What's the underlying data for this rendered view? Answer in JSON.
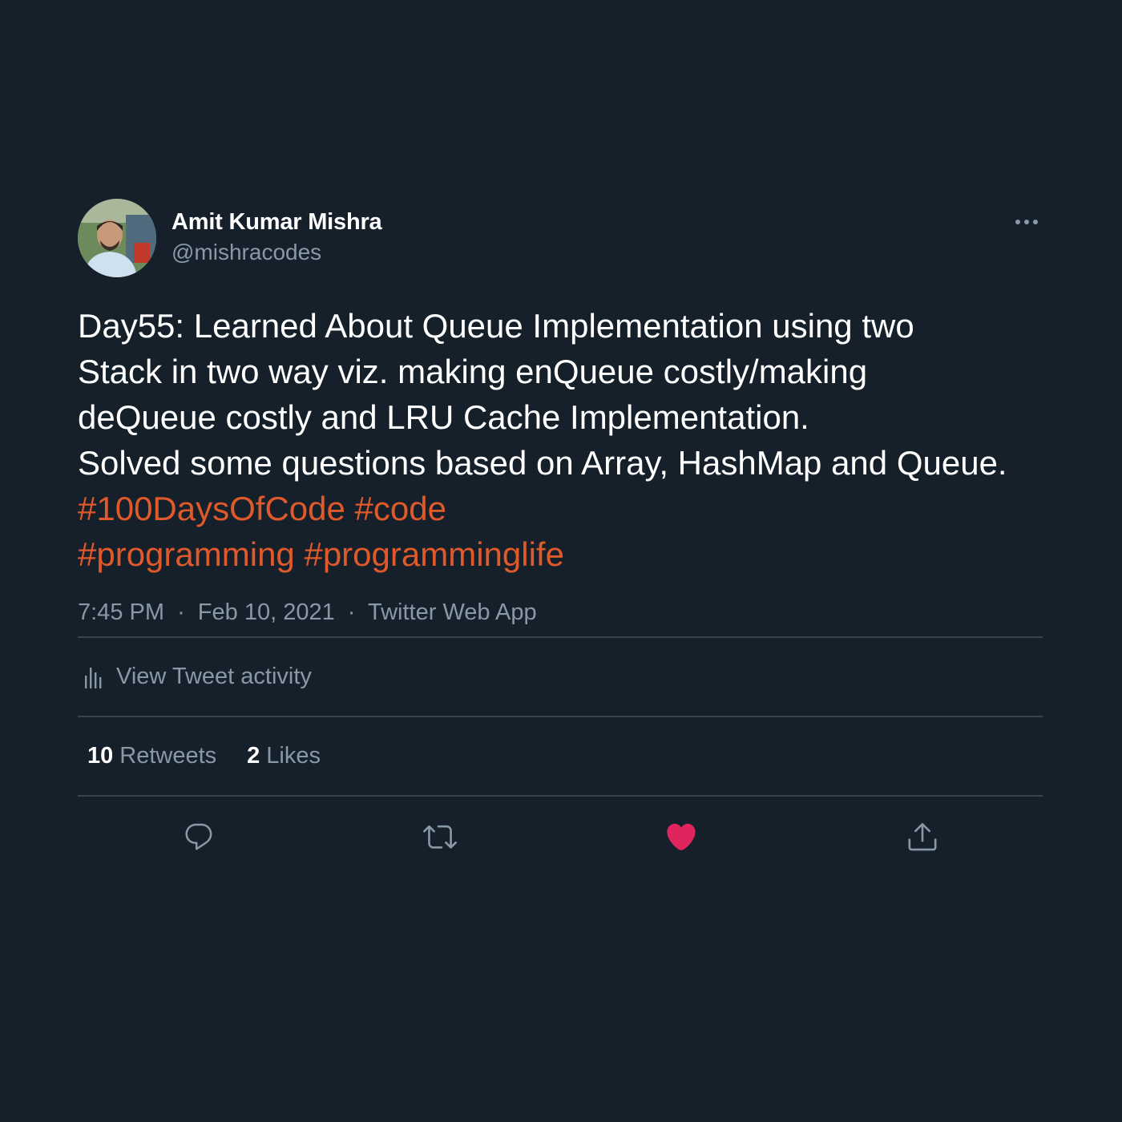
{
  "author": {
    "name": "Amit Kumar Mishra",
    "handle": "@mishracodes"
  },
  "tweet": {
    "text": "Day55: Learned About Queue Implementation using two Stack in two way viz. making enQueue costly/making deQueue costly and LRU Cache Implementation.\nSolved some questions based on Array, HashMap and Queue.",
    "hashtags": [
      "#100DaysOfCode",
      "#code",
      "#programming",
      "#programminglife"
    ]
  },
  "meta": {
    "time": "7:45 PM",
    "date": "Feb 10, 2021",
    "separator": "·",
    "source": "Twitter Web App"
  },
  "activity": {
    "label": "View Tweet activity",
    "icon": "bar-chart-icon"
  },
  "stats": {
    "retweets_count": "10",
    "retweets_label": "Retweets",
    "likes_count": "2",
    "likes_label": "Likes"
  },
  "actions": [
    {
      "icon": "reply-icon"
    },
    {
      "icon": "retweet-icon"
    },
    {
      "icon": "heart-icon",
      "liked": true
    },
    {
      "icon": "share-icon"
    }
  ],
  "colors": {
    "background": "#15202b",
    "hashtag": "#e0592a",
    "secondary_text": "#8899a6",
    "divider": "#38444d",
    "liked": "#e0245e"
  }
}
